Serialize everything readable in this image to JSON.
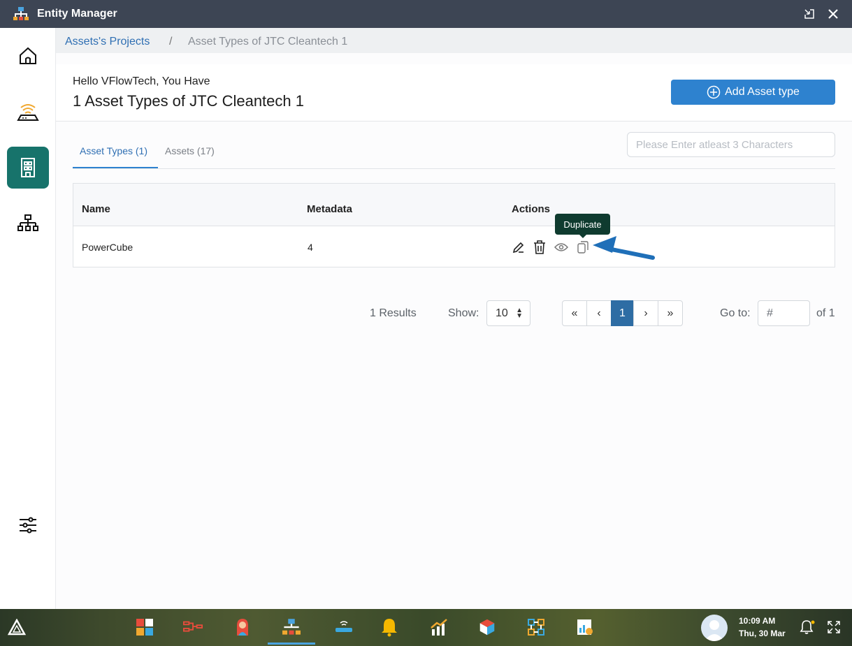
{
  "window": {
    "title": "Entity Manager"
  },
  "breadcrumb": {
    "link": "Assets's Projects",
    "separator": "/",
    "current": "Asset Types of JTC Cleantech 1"
  },
  "header": {
    "greeting": "Hello VFlowTech, You Have",
    "heading": "1 Asset Types of JTC Cleantech 1",
    "add_button": "Add Asset type"
  },
  "tabs": [
    {
      "label": "Asset Types (1)",
      "active": true
    },
    {
      "label": "Assets (17)",
      "active": false
    }
  ],
  "search": {
    "placeholder": "Please Enter atleast 3 Characters",
    "value": ""
  },
  "table": {
    "columns": [
      "Name",
      "Metadata",
      "Actions"
    ],
    "rows": [
      {
        "name": "PowerCube",
        "metadata": "4"
      }
    ],
    "actions": [
      "edit-icon",
      "delete-icon",
      "view-icon",
      "duplicate-icon"
    ]
  },
  "tooltip": {
    "text": "Duplicate"
  },
  "pagination": {
    "results": "1 Results",
    "show_label": "Show:",
    "show_value": "10",
    "first": "«",
    "prev": "‹",
    "current_page": "1",
    "next": "›",
    "last": "»",
    "goto_label": "Go to:",
    "goto_placeholder": "#",
    "of_label": "of 1"
  },
  "taskbar": {
    "time": "10:09 AM",
    "date": "Thu, 30 Mar"
  },
  "colors": {
    "titlebar": "#3d4554",
    "accent": "#2e82cf",
    "rail_active": "#17736b",
    "tooltip": "#0f3b2f",
    "page_active": "#2e6da4"
  }
}
